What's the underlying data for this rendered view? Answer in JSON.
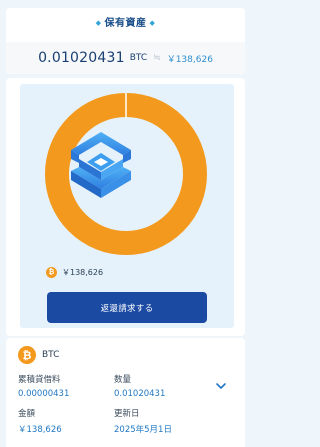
{
  "holdings": {
    "title": "保有資産",
    "title_deco": "◆",
    "total_amount": "0.01020431",
    "total_unit": "BTC",
    "approx_symbol": "≒",
    "total_jpy": "￥138,626"
  },
  "chart_data": {
    "type": "pie",
    "style": "donut",
    "categories": [
      "BTC"
    ],
    "values": [
      100
    ],
    "colors": [
      "#f39a1e"
    ],
    "value_labels": [
      "￥138,626"
    ]
  },
  "legend": {
    "items": [
      {
        "badge": "₿",
        "value": "￥138,626",
        "color": "#f39a1e"
      }
    ]
  },
  "actions": {
    "return_request_label": "返還請求する"
  },
  "asset": {
    "badge": "₿",
    "name": "BTC",
    "cumulative_fee_label": "累積貸借料",
    "cumulative_fee_value": "0.00000431",
    "quantity_label": "数量",
    "quantity_value": "0.01020431",
    "amount_label": "金額",
    "amount_value": "￥138,626",
    "updated_label": "更新日",
    "updated_value": "2025年5月1日"
  },
  "icons": {
    "logo": "brand-logo-icon",
    "expand": "chevron-down-icon"
  },
  "colors": {
    "accent_orange": "#f39a1e",
    "primary_blue": "#1b4aa3",
    "value_blue": "#2078c4",
    "background": "#eef5fb"
  }
}
